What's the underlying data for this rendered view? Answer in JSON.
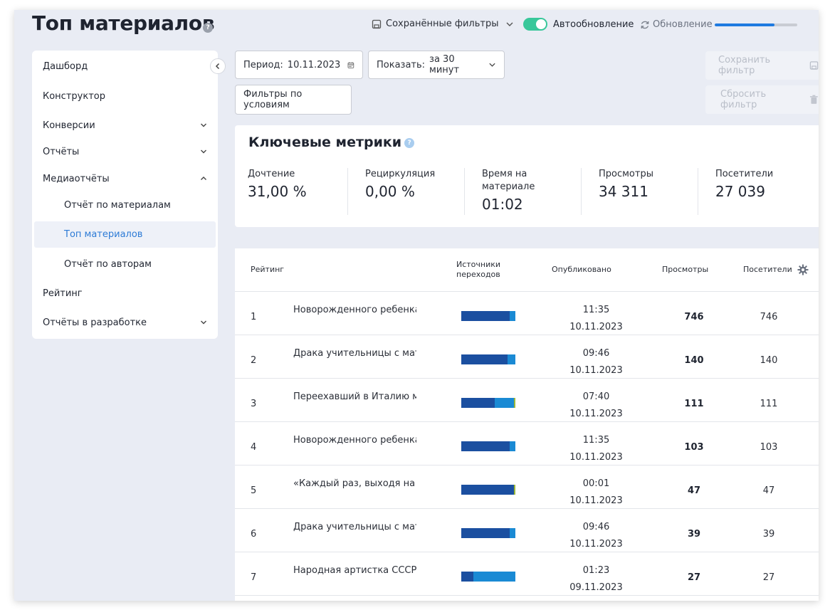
{
  "header": {
    "title": "Топ материалов",
    "saved_filters": "Сохранённые фильтры",
    "auto_update": "Автообновление",
    "refresh": "Обновление",
    "refresh_progress": 0.72
  },
  "sidebar": {
    "items": [
      {
        "label": "Дашборд"
      },
      {
        "label": "Конструктор"
      },
      {
        "label": "Конверсии"
      },
      {
        "label": "Отчёты"
      },
      {
        "label": "Медиаотчёты"
      },
      {
        "label": "Отчёт по материалам"
      },
      {
        "label": "Топ материалов"
      },
      {
        "label": "Отчёт по авторам"
      },
      {
        "label": "Рейтинг"
      },
      {
        "label": "Отчёты в разработке"
      }
    ]
  },
  "filters": {
    "period_label": "Период:",
    "period_value": "10.11.2023",
    "show_label": "Показать:",
    "show_value": "за 30 минут",
    "conditions": "Фильтры по условиям",
    "save_filter": "Сохранить фильтр",
    "reset_filter": "Сбросить фильтр"
  },
  "metrics": {
    "title": "Ключевые метрики",
    "items": [
      {
        "label": "Дочтение",
        "value": "31,00 %"
      },
      {
        "label": "Рециркуляция",
        "value": "0,00 %"
      },
      {
        "label": "Время на материале",
        "value": "01:02"
      },
      {
        "label": "Просмотры",
        "value": "34 311"
      },
      {
        "label": "Посетители",
        "value": "27 039"
      }
    ]
  },
  "table": {
    "headers": {
      "rank": "Рейтинг",
      "sources": "Источники переходов",
      "published": "Опубликовано",
      "views": "Просмотры",
      "visitors": "Посетители"
    },
    "colors": {
      "dark": "#1b4fa0",
      "light": "#1a8ad4",
      "tiny": "#9ab83a"
    },
    "rows": [
      {
        "rank": "1",
        "title": "Новорожденного ребенка н",
        "time": "11:35",
        "date": "10.11.2023",
        "views": "746",
        "visitors": "746",
        "sources": [
          0.9,
          0.1,
          0.0
        ]
      },
      {
        "rank": "2",
        "title": "Драка учительницы с матер",
        "time": "09:46",
        "date": "10.11.2023",
        "views": "140",
        "visitors": "140",
        "sources": [
          0.85,
          0.15,
          0.0
        ]
      },
      {
        "rank": "3",
        "title": "Переехавший в Италию мо",
        "time": "07:40",
        "date": "10.11.2023",
        "views": "111",
        "visitors": "111",
        "sources": [
          0.62,
          0.36,
          0.02
        ]
      },
      {
        "rank": "4",
        "title": "Новорожденного ребенка н",
        "time": "11:35",
        "date": "10.11.2023",
        "views": "103",
        "visitors": "103",
        "sources": [
          0.89,
          0.11,
          0.0
        ]
      },
      {
        "rank": "5",
        "title": "«Каждый раз, выходя на ул",
        "time": "00:01",
        "date": "10.11.2023",
        "views": "47",
        "visitors": "47",
        "sources": [
          0.97,
          0.0,
          0.03
        ]
      },
      {
        "rank": "6",
        "title": "Драка учительницы с матер",
        "time": "09:46",
        "date": "10.11.2023",
        "views": "39",
        "visitors": "39",
        "sources": [
          0.89,
          0.11,
          0.0
        ]
      },
      {
        "rank": "7",
        "title": "Народная артистка СССР об",
        "time": "01:23",
        "date": "09.11.2023",
        "views": "27",
        "visitors": "27",
        "sources": [
          0.22,
          0.78,
          0.0
        ]
      }
    ]
  }
}
